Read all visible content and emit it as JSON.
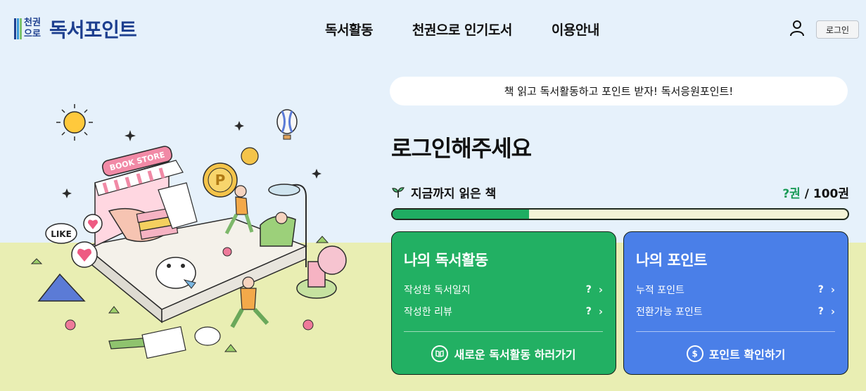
{
  "header": {
    "logo_mark_top": "천권",
    "logo_mark_bottom": "으로",
    "logo_text": "독서포인트",
    "nav": [
      "독서활동",
      "천권으로 인기도서",
      "이용안내"
    ],
    "user_icon": "user-icon",
    "login_label": "로그인"
  },
  "banner": {
    "text": "책 읽고 독서활동하고 포인트 받자! 독서응원포인트!"
  },
  "main": {
    "welcome": "로그인해주세요",
    "read_label": "지금까지 읽은 책",
    "read_count": "?권",
    "read_total": " / 100권",
    "progress": 0.3
  },
  "cards": {
    "activity": {
      "title": "나의 독서활동",
      "items": [
        {
          "label": "작성한 독서일지",
          "value": "?"
        },
        {
          "label": "작성한 리뷰",
          "value": "?"
        }
      ],
      "action": "새로운 독서활동 하러가기",
      "icon": "book-icon",
      "color": "#22b063"
    },
    "points": {
      "title": "나의 포인트",
      "items": [
        {
          "label": "누적 포인트",
          "value": "?"
        },
        {
          "label": "전환가능 포인트",
          "value": "?"
        }
      ],
      "action": "포인트 확인하기",
      "icon": "dollar-icon",
      "color": "#4a7fe8"
    }
  },
  "illustration": {
    "store_sign": "BOOK STORE",
    "bubble_text": "LIKE",
    "coin_letter": "P"
  }
}
